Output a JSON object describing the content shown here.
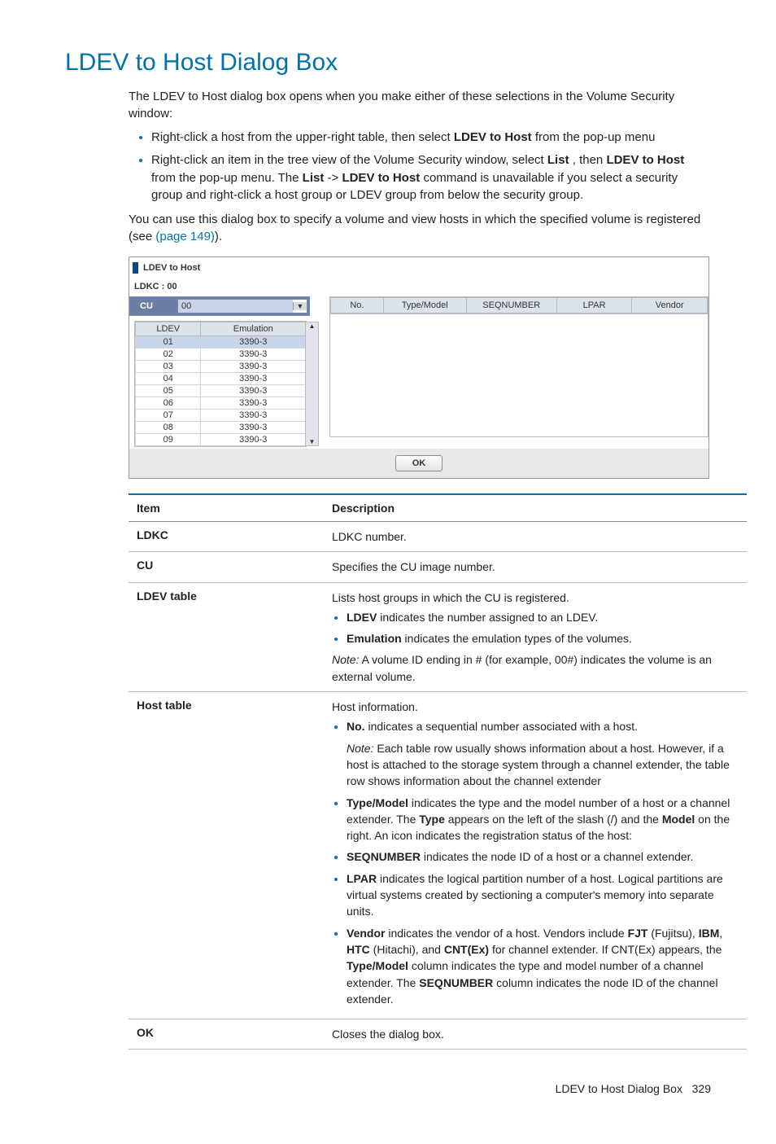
{
  "title": "LDEV to Host Dialog Box",
  "intro": "The LDEV to Host dialog box opens when you make either of these selections in the Volume Security window:",
  "bullets": {
    "b1_pre": "Right-click a host from the upper-right table, then select ",
    "b1_bold": "LDEV to Host",
    "b1_post": " from the pop-up menu",
    "b2_pre": "Right-click an item in the tree view of the Volume Security window, select ",
    "b2_bold1": "List",
    "b2_mid1": " , then ",
    "b2_bold2": "LDEV to Host",
    "b2_mid2": " from the pop-up menu. The ",
    "b2_bold3": "List",
    "b2_arrow": "  -> ",
    "b2_bold4": "LDEV to Host",
    "b2_post": " command is unavailable if you select a security group and right-click a host group or LDEV group from below the security group."
  },
  "para2_pre": "You can use this dialog box to specify a volume and view hosts in which the specified volume is registered (see ",
  "para2_link": "(page 149)",
  "para2_post": ").",
  "ss": {
    "title": "LDEV to Host",
    "ldkc": "LDKC : 00",
    "cu_label": "CU",
    "cu_value": "00",
    "ldev_hdr1": "LDEV",
    "ldev_hdr2": "Emulation",
    "rows": [
      {
        "ldev": "01",
        "emu": "3390-3"
      },
      {
        "ldev": "02",
        "emu": "3390-3"
      },
      {
        "ldev": "03",
        "emu": "3390-3"
      },
      {
        "ldev": "04",
        "emu": "3390-3"
      },
      {
        "ldev": "05",
        "emu": "3390-3"
      },
      {
        "ldev": "06",
        "emu": "3390-3"
      },
      {
        "ldev": "07",
        "emu": "3390-3"
      },
      {
        "ldev": "08",
        "emu": "3390-3"
      },
      {
        "ldev": "09",
        "emu": "3390-3"
      }
    ],
    "host_cols": [
      "No.",
      "Type/Model",
      "SEQNUMBER",
      "LPAR",
      "Vendor"
    ],
    "ok": "OK"
  },
  "desc_hdr_item": "Item",
  "desc_hdr_desc": "Description",
  "desc": {
    "ldkc_item": "LDKC",
    "ldkc_desc": "LDKC number.",
    "cu_item": "CU",
    "cu_desc": "Specifies the CU image number.",
    "ldevt_item": "LDEV table",
    "ldevt_intro": "Lists host groups in which the CU is registered.",
    "ldevt_b1_b": "LDEV",
    "ldevt_b1_t": " indicates the number assigned to an LDEV.",
    "ldevt_b2_b": "Emulation",
    "ldevt_b2_t": " indicates the emulation types of the volumes.",
    "ldevt_note_lbl": "Note:",
    "ldevt_note": " A volume ID ending in # (for example, 00#) indicates the volume is an external volume.",
    "hostt_item": "Host table",
    "hostt_intro": "Host information.",
    "h_b1_b": "No.",
    "h_b1_t": " indicates a sequential number associated with a host.",
    "h_b1_note_lbl": "Note:",
    "h_b1_note": " Each table row usually shows information about a host. However, if a host is attached to the storage system through a channel extender, the table row shows information about the channel extender",
    "h_b2_b": "Type/Model",
    "h_b2_t1": " indicates the type and the model number of a host or a channel extender. The ",
    "h_b2_b2": "Type",
    "h_b2_t2": " appears on the left of the slash (/) and the ",
    "h_b2_b3": "Model",
    "h_b2_t3": " on the right. An icon indicates the registration status of the host:",
    "h_b3_b": "SEQNUMBER",
    "h_b3_t": " indicates the node ID of a host or a channel extender.",
    "h_b4_b": "LPAR",
    "h_b4_t": " indicates the logical partition number of a host. Logical partitions are virtual systems created by sectioning a computer's memory into separate units.",
    "h_b5_b": "Vendor",
    "h_b5_t1": " indicates the vendor of a host. Vendors include ",
    "h_b5_b2": "FJT",
    "h_b5_t2": " (Fujitsu), ",
    "h_b5_b3": "IBM",
    "h_b5_t3": ", ",
    "h_b5_b4": "HTC",
    "h_b5_t4": " (Hitachi), and ",
    "h_b5_b5": "CNT(Ex)",
    "h_b5_t5": " for channel extender. If CNT(Ex) appears, the ",
    "h_b5_b6": "Type/Model",
    "h_b5_t6": " column indicates the type and model number of a channel extender. The ",
    "h_b5_b7": "SEQNUMBER",
    "h_b5_t7": " column indicates the node ID of the channel extender.",
    "ok_item": "OK",
    "ok_desc": "Closes the dialog box."
  },
  "footer_text": "LDEV to Host Dialog Box",
  "footer_page": "329"
}
